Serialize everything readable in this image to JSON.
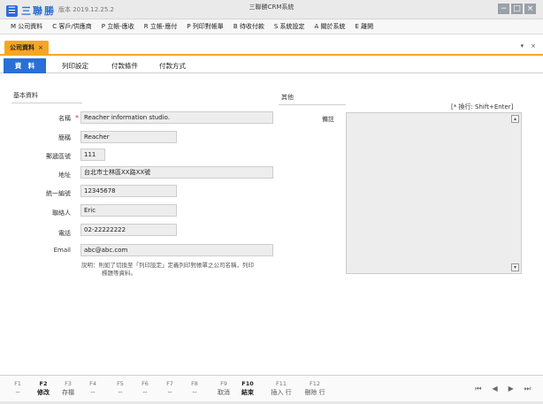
{
  "app": {
    "logo_text": "三聯勝",
    "version": "版本 2019.12.25.2",
    "title": "三聯勝CRM系統"
  },
  "window": {
    "min": "−",
    "max": "□",
    "close": "×"
  },
  "menu": [
    "M 公司資料",
    "C 客戶/供應商",
    "P 立帳-應收",
    "R 立帳-應付",
    "P 列印對帳單",
    "B 待收付款",
    "S 系統設定",
    "A 關於系統",
    "E 離開"
  ],
  "doc_tab": {
    "label": "公司資料",
    "close": "×"
  },
  "tab_controls": {
    "dropdown": "▾",
    "close": "×"
  },
  "subtabs": [
    "資　料",
    "列印設定",
    "付款條件",
    "付款方式"
  ],
  "sections": {
    "basic": "基本資料",
    "other": "其他"
  },
  "fields": [
    {
      "label": "名稱",
      "value": "Reacher information studio."
    },
    {
      "label": "簡稱",
      "value": "Reacher"
    },
    {
      "label": "郵遞區號",
      "value": "111"
    },
    {
      "label": "地址",
      "value": "台北市士林區XX路XX號"
    },
    {
      "label": "統一編號",
      "value": "12345678"
    },
    {
      "label": "聯絡人",
      "value": "Eric"
    },
    {
      "label": "電話",
      "value": "02-22222222"
    },
    {
      "label": "Email",
      "value": "abc@abc.com"
    }
  ],
  "required_mark": "*",
  "hint": {
    "line1": "說明：則如了切換至「列印設定」定義列印對帳單之公司名稱，列印",
    "line2": "標題等資料。"
  },
  "notes": {
    "label": "備註",
    "shortcut": "[* 換行: Shift+Enter]"
  },
  "fkeys": [
    {
      "key": "F1",
      "action": "--"
    },
    {
      "key": "F2",
      "action": "修改",
      "bold": true
    },
    {
      "key": "F3",
      "action": "存檔"
    },
    {
      "key": "F4",
      "action": "--"
    },
    {
      "key": "F5",
      "action": "--"
    },
    {
      "key": "F6",
      "action": "--"
    },
    {
      "key": "F7",
      "action": "--"
    },
    {
      "key": "F8",
      "action": "--"
    },
    {
      "key": "F9",
      "action": "取消"
    },
    {
      "key": "F10",
      "action": "結束",
      "bold": true
    },
    {
      "key": "F11",
      "action": "插入 行"
    },
    {
      "key": "F12",
      "action": "刪除 行"
    }
  ],
  "nav": [
    "⏮",
    "◀",
    "▶",
    "⏭"
  ]
}
